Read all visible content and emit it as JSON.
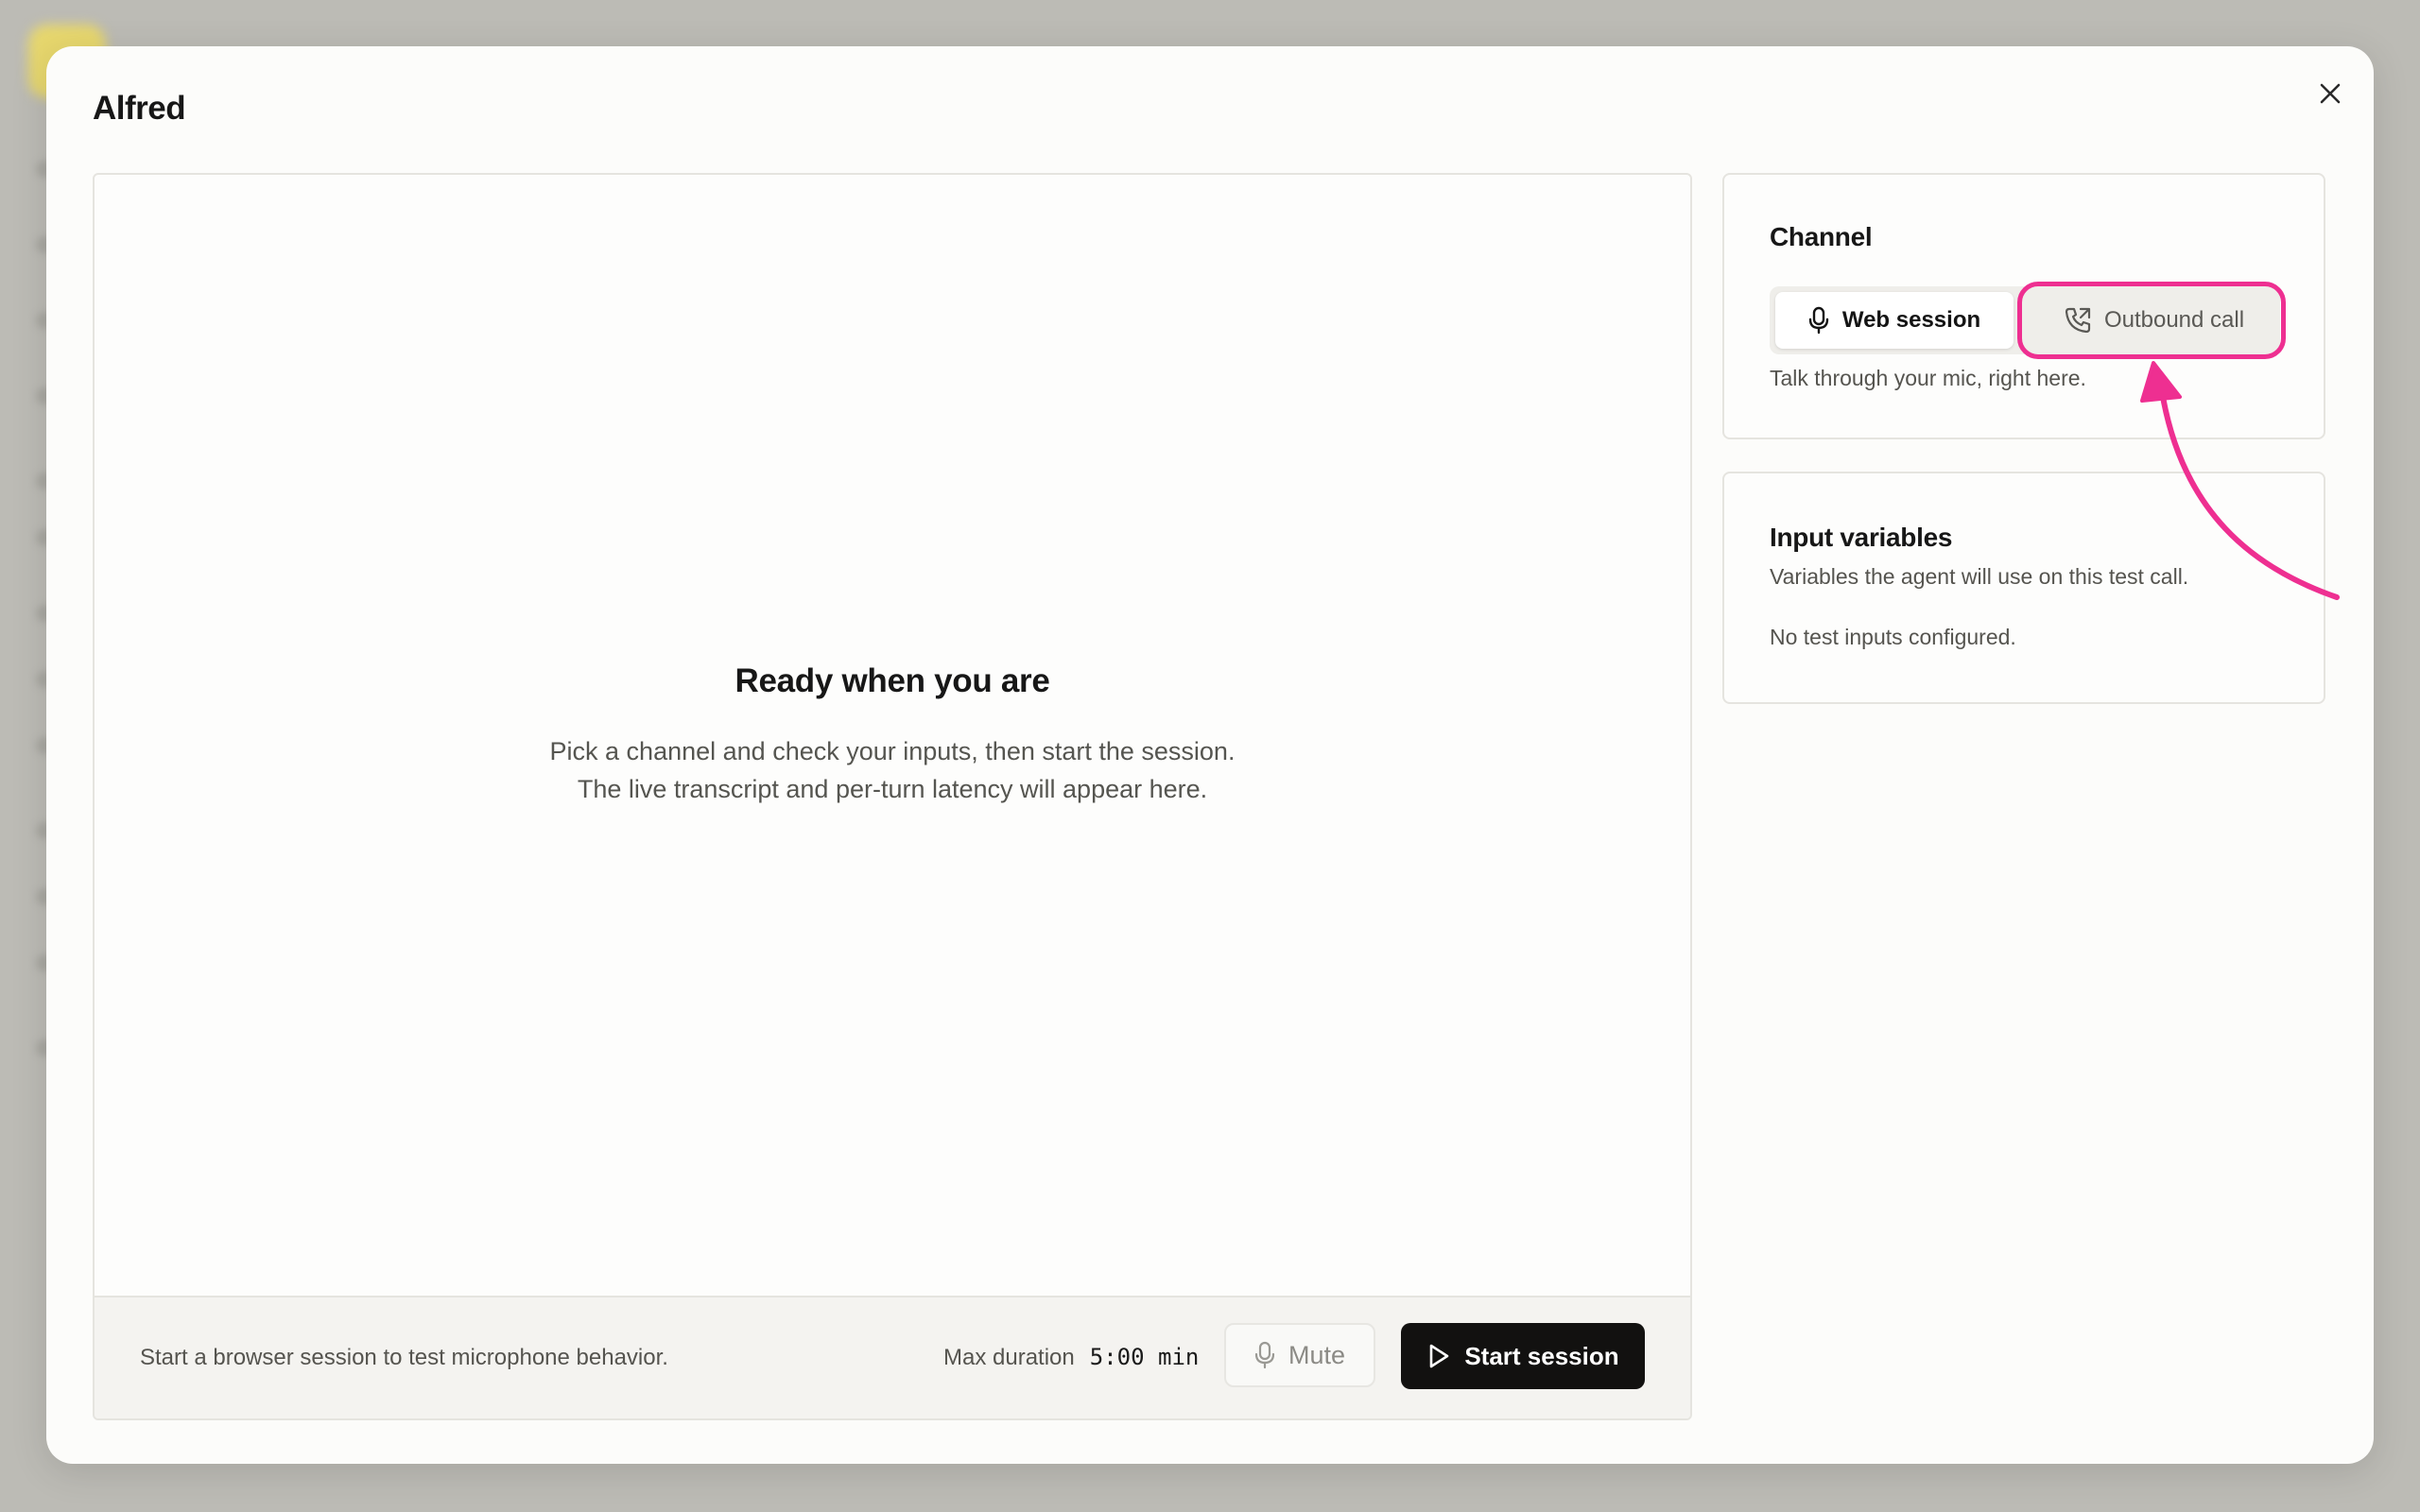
{
  "modal": {
    "title": "Alfred"
  },
  "empty_state": {
    "title": "Ready when you are",
    "line1": "Pick a channel and check your inputs, then start the session.",
    "line2": "The live transcript and per-turn latency will appear here."
  },
  "footer": {
    "hint": "Start a browser session to test microphone behavior.",
    "max_duration_label": "Max duration",
    "max_duration_value": "5:00 min",
    "mute_label": "Mute",
    "start_label": "Start session"
  },
  "channel": {
    "title": "Channel",
    "options": [
      {
        "label": "Web session",
        "icon": "microphone-icon",
        "selected": true
      },
      {
        "label": "Outbound call",
        "icon": "phone-outgoing-icon",
        "selected": false
      }
    ],
    "description": "Talk through your mic, right here."
  },
  "input_variables": {
    "title": "Input variables",
    "subtitle": "Variables the agent will use on this test call.",
    "empty": "No test inputs configured."
  },
  "colors": {
    "accent_highlight": "#ee2f91",
    "primary_button": "#121110",
    "backdrop": "#bcbbb5"
  }
}
